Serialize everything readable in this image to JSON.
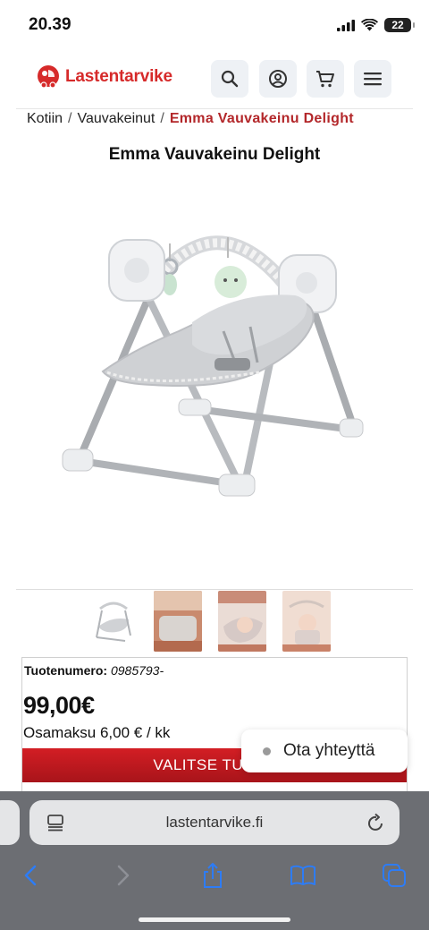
{
  "status": {
    "time": "20.39",
    "battery": "22"
  },
  "header": {
    "brand": "Lastentarvike",
    "brand_color": "#d62a2a",
    "icons": [
      "search-icon",
      "account-icon",
      "cart-icon",
      "menu-icon"
    ]
  },
  "breadcrumb": {
    "items": [
      "Kotiin",
      "Vauvakeinut"
    ],
    "separator": "/",
    "current": "Emma Vauvakeinu Delight"
  },
  "product": {
    "title": "Emma Vauvakeinu Delight",
    "sku_label": "Tuotenumero:",
    "sku_value": "0985793-",
    "price": "99,00€",
    "installment": "Osamaksu 6,00 € / kk",
    "select_button": "VALITSE TUOTE",
    "thumbnails": 4
  },
  "contact": {
    "label": "Ota yhteyttä"
  },
  "browser": {
    "url": "lastentarvike.fi",
    "toolbar": [
      "back-icon",
      "forward-icon",
      "share-icon",
      "bookmarks-icon",
      "tabs-icon"
    ]
  },
  "colors": {
    "accent": "#d31e24",
    "toolbar_bg": "#6c6e73",
    "ios_blue": "#2d7cf6"
  }
}
